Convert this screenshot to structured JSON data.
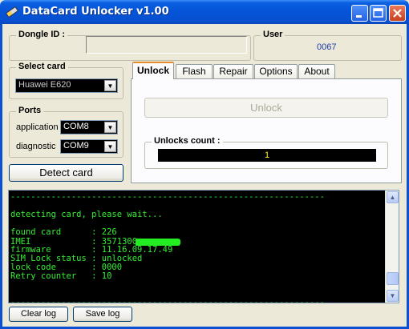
{
  "window": {
    "title": "DataCard Unlocker v1.00"
  },
  "dongle": {
    "label": "Dongle ID :",
    "value": ""
  },
  "user": {
    "label": "User",
    "value": "0067"
  },
  "select_card": {
    "label": "Select card",
    "value": "Huawei E620"
  },
  "ports": {
    "label": "Ports",
    "application": {
      "label": "application",
      "value": "COM8"
    },
    "diagnostic": {
      "label": "diagnostic",
      "value": "COM9"
    }
  },
  "detect_button": "Detect card",
  "tabs": [
    {
      "label": "Unlock",
      "active": true
    },
    {
      "label": "Flash"
    },
    {
      "label": "Repair"
    },
    {
      "label": "Options"
    },
    {
      "label": "About"
    }
  ],
  "unlock_tab": {
    "unlock_button": "Unlock",
    "unlocks_count_label": "Unlocks count :",
    "unlocks_count_value": "1"
  },
  "log": {
    "lines": [
      "--------------------------------------------------------------",
      "",
      "detecting card, please wait...",
      "",
      "found card      : 226",
      "IMEI            : 3571300",
      "firmware        : 11.16.09.17.49",
      "SIM Lock status : unlocked",
      "lock code       : 0000",
      "Retry counter   : 10",
      "",
      "",
      "--------------------------------------------------------------"
    ]
  },
  "clear_log": "Clear log",
  "save_log": "Save log",
  "colors": {
    "titlebar": "#0554d8",
    "console_text": "#33ee33",
    "active_tab_accent": "#e68b2c",
    "user_value": "#1a3aa8"
  }
}
